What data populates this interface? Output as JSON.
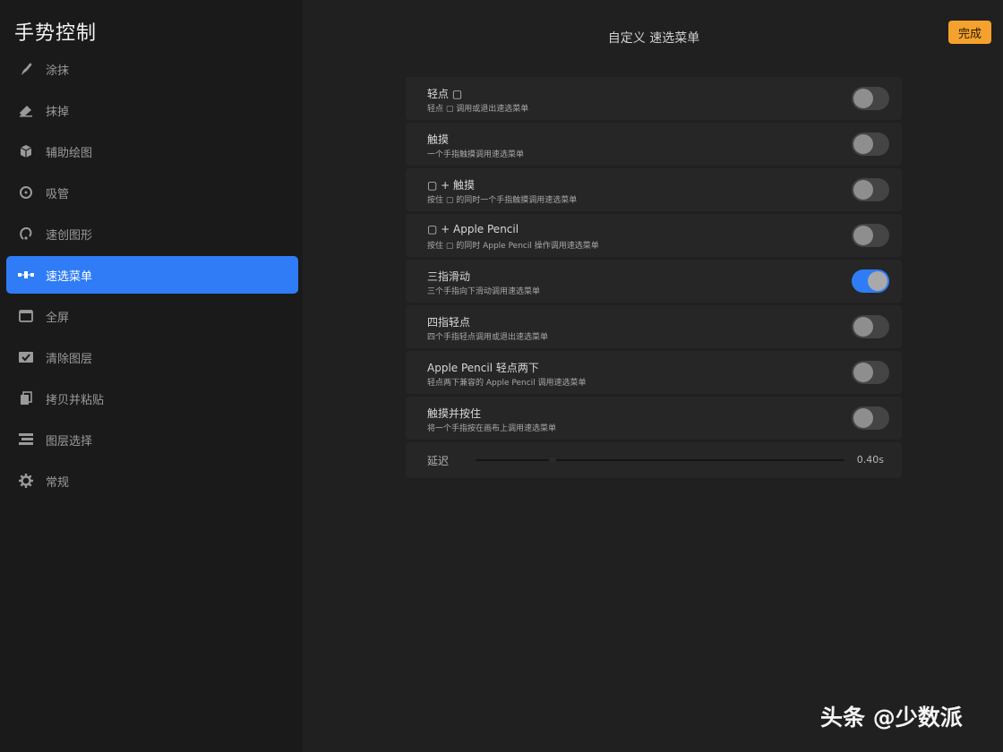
{
  "sidebar": {
    "title": "手势控制",
    "items": [
      {
        "label": "涂抹",
        "icon": "smudge-brush-icon"
      },
      {
        "label": "抹掉",
        "icon": "eraser-icon"
      },
      {
        "label": "辅助绘图",
        "icon": "cube-icon"
      },
      {
        "label": "吸管",
        "icon": "eyedropper-ring-icon"
      },
      {
        "label": "速创图形",
        "icon": "quickshape-icon"
      },
      {
        "label": "速选菜单",
        "icon": "quickmenu-icon",
        "active": true
      },
      {
        "label": "全屏",
        "icon": "fullscreen-icon"
      },
      {
        "label": "清除图层",
        "icon": "clear-layer-icon"
      },
      {
        "label": "拷贝并粘贴",
        "icon": "copy-paste-icon"
      },
      {
        "label": "图层选择",
        "icon": "layer-select-icon"
      },
      {
        "label": "常规",
        "icon": "gear-icon"
      }
    ]
  },
  "header": {
    "title": "自定义 速选菜单",
    "done_label": "完成"
  },
  "settings": {
    "rows": [
      {
        "title": "轻点 ▢",
        "subtitle": "轻点 ▢ 调用或退出速选菜单",
        "enabled": false
      },
      {
        "title": "触摸",
        "subtitle": "一个手指触摸调用速选菜单",
        "enabled": false
      },
      {
        "title": "▢ + 触摸",
        "subtitle": "按住 ▢ 的同时一个手指触摸调用速选菜单",
        "enabled": false
      },
      {
        "title": "▢ + Apple Pencil",
        "subtitle": "按住 ▢ 的同时 Apple Pencil 操作调用速选菜单",
        "enabled": false
      },
      {
        "title": "三指滑动",
        "subtitle": "三个手指向下滑动调用速选菜单",
        "enabled": true
      },
      {
        "title": "四指轻点",
        "subtitle": "四个手指轻点调用或退出速选菜单",
        "enabled": false
      },
      {
        "title": "Apple Pencil 轻点两下",
        "subtitle": "轻点两下兼容的 Apple Pencil 调用速选菜单",
        "enabled": false
      },
      {
        "title": "触摸并按住",
        "subtitle": "将一个手指按在画布上调用速选菜单",
        "enabled": false
      }
    ],
    "delay": {
      "label": "延迟",
      "value": "0.40s"
    }
  },
  "watermark": "头条 @少数派",
  "colors": {
    "accent": "#2f7cf6",
    "done_button": "#f4a22d"
  }
}
